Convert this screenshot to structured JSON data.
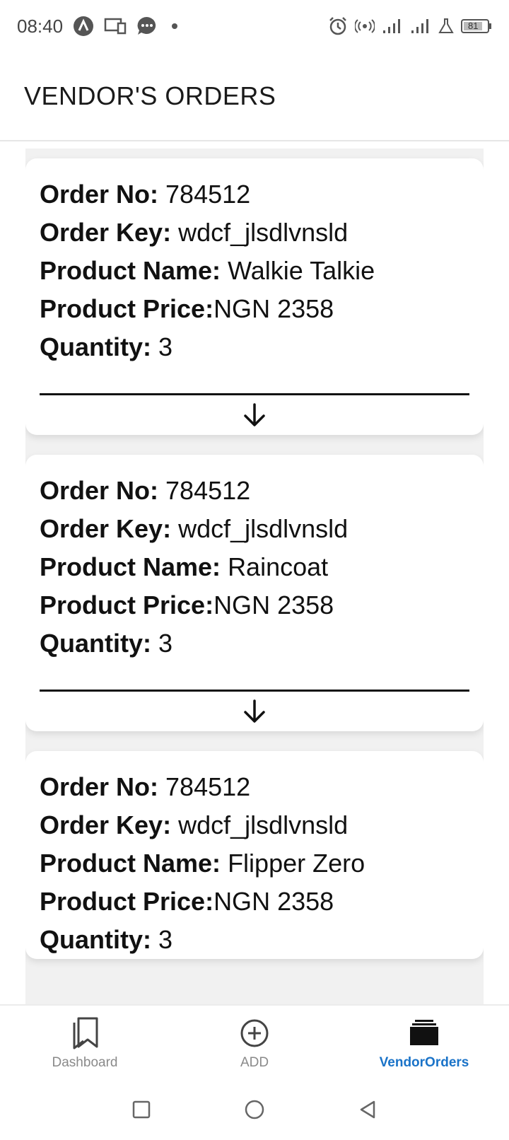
{
  "status_bar": {
    "time": "08:40",
    "battery": "81",
    "icons": [
      "a-icon",
      "screen-cast-icon",
      "chat-bubble-icon",
      "dot-icon",
      "alarm-icon",
      "hotspot-icon",
      "signal-icon",
      "signal-icon",
      "lab-flask-icon",
      "battery-icon"
    ]
  },
  "app_bar": {
    "title": "VENDOR'S ORDERS"
  },
  "labels": {
    "order_no": "Order No:",
    "order_key": "Order Key:",
    "product_name": "Product Name:",
    "product_price": "Product Price:",
    "quantity": "Quantity:"
  },
  "orders": [
    {
      "order_no": "784512",
      "order_key": "wdcf_jlsdlvnsld",
      "product_name": "Walkie Talkie",
      "product_price": "NGN 2358",
      "quantity": "3"
    },
    {
      "order_no": "784512",
      "order_key": "wdcf_jlsdlvnsld",
      "product_name": "Raincoat",
      "product_price": "NGN 2358",
      "quantity": "3"
    },
    {
      "order_no": "784512",
      "order_key": "wdcf_jlsdlvnsld",
      "product_name": "Flipper Zero",
      "product_price": "NGN 2358",
      "quantity": "3"
    }
  ],
  "bottom_nav": {
    "items": [
      {
        "label": "Dashboard",
        "icon": "bookmarks-icon",
        "active": false
      },
      {
        "label": "ADD",
        "icon": "add-circle-icon",
        "active": false
      },
      {
        "label": "VendorOrders",
        "icon": "layers-icon",
        "active": true
      }
    ],
    "active_color": "#1a73c8",
    "inactive_color": "#8a8a8a"
  },
  "system_nav": {
    "icons": [
      "recents-square-icon",
      "home-circle-icon",
      "back-triangle-icon"
    ]
  }
}
